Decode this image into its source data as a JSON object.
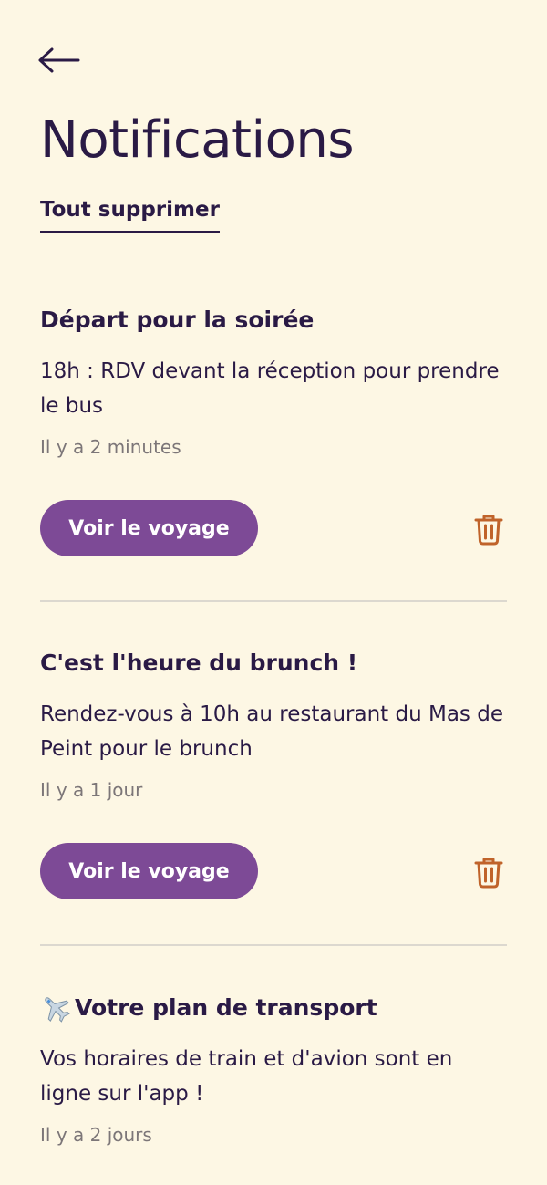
{
  "header": {
    "title": "Notifications",
    "clear_all_label": "Tout supprimer"
  },
  "notifications": [
    {
      "title": "Départ pour la soirée",
      "body": "18h : RDV devant la réception pour prendre le bus",
      "time": "Il y a 2 minutes",
      "action_label": "Voir le voyage"
    },
    {
      "title": "C'est l'heure du brunch !",
      "body": "Rendez-vous à 10h au restaurant du Mas de Peint pour le brunch",
      "time": "Il y a 1 jour",
      "action_label": "Voir le voyage"
    },
    {
      "title": "Votre plan de transport",
      "title_icon": "airplane-emoji",
      "body": "Vos horaires de train et d'avion sont en ligne sur l'app !",
      "time": "Il y a 2 jours"
    }
  ],
  "icons": {
    "back": "arrow-left-icon",
    "delete": "trash-icon"
  },
  "colors": {
    "background": "#fdf7e4",
    "text": "#2a1a45",
    "accent_button": "#7d4a96",
    "trash": "#c0632a",
    "muted": "#7c7678",
    "divider": "#dcd8cf"
  }
}
